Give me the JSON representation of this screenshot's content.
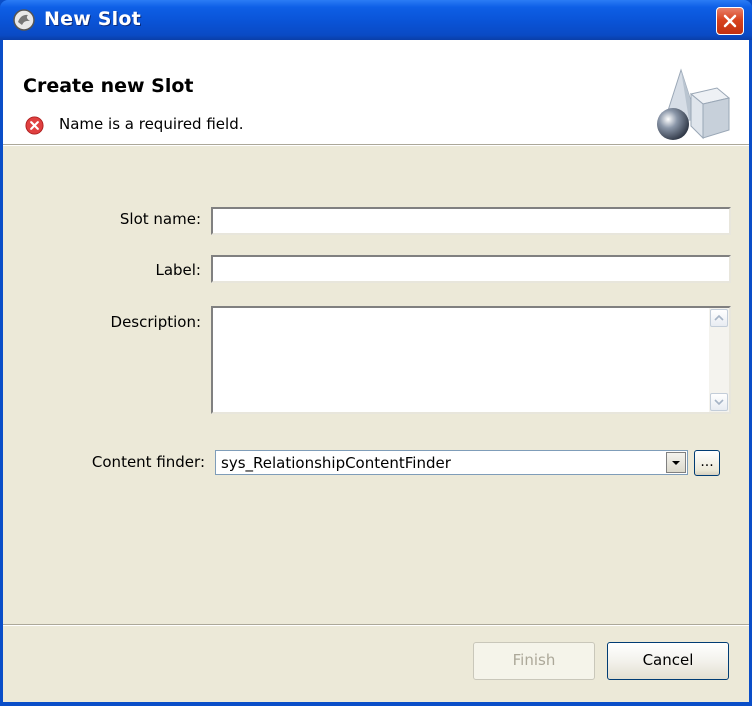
{
  "window": {
    "title": "New Slot",
    "app_icon": "wizard-app-icon",
    "close_icon": "close-x-icon"
  },
  "header": {
    "title": "Create new Slot",
    "message": "Name is a required field.",
    "message_icon": "error-icon",
    "art_icon": "shapes-wizard-icon"
  },
  "form": {
    "slot_name_label": "Slot name:",
    "slot_name_value": "",
    "label_label": "Label:",
    "label_value": "",
    "description_label": "Description:",
    "description_value": "",
    "content_finder_label": "Content finder:",
    "content_finder_value": "sys_RelationshipContentFinder",
    "browse_label": "..."
  },
  "buttons": {
    "finish_label": "Finish",
    "finish_enabled": false,
    "cancel_label": "Cancel"
  },
  "colors": {
    "title_bar": "#0a53d6",
    "dialog_bg": "#ece9d8",
    "error_red": "#e04040"
  }
}
